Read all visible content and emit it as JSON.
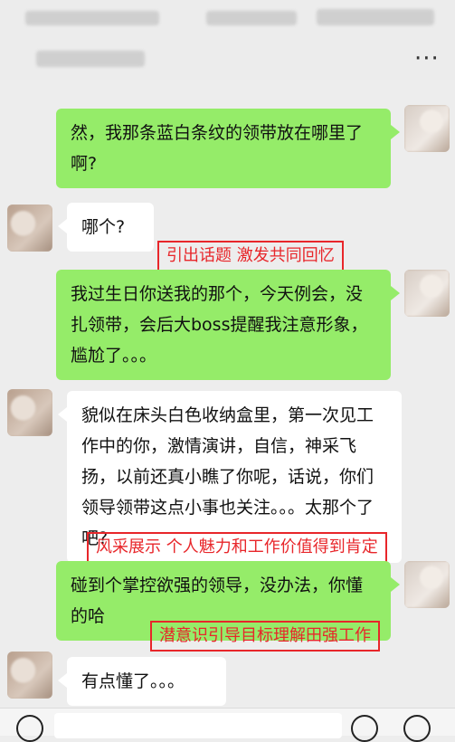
{
  "messages": [
    {
      "side": "right",
      "text": "然，我那条蓝白条纹的领带放在哪里了啊?"
    },
    {
      "side": "left",
      "text": "哪个?"
    },
    {
      "side": "right",
      "text": "我过生日你送我的那个，今天例会，没扎领带，会后大boss提醒我注意形象，尴尬了。。。"
    },
    {
      "side": "left",
      "text": "貌似在床头白色收纳盒里，第一次见工作中的你，激情演讲，自信，神采飞扬，以前还真小瞧了你呢，话说，你们领导领带这点小事也关注。。。太那个了吧?"
    },
    {
      "side": "right",
      "text": "碰到个掌控欲强的领导，没办法，你懂的哈"
    },
    {
      "side": "left",
      "text": "有点懂了。。。"
    }
  ],
  "annotations": [
    "引出话题 激发共同回忆",
    "风采展示  个人魅力和工作价值得到肯定",
    "潜意识引导目标理解田强工作"
  ],
  "header": {
    "more_icon": "more-icon"
  },
  "bottom_bar": {
    "voice_icon": "voice-icon",
    "emoji_icon": "emoji-icon",
    "add_icon": "add-icon"
  },
  "colors": {
    "sent_bubble": "#95ec69",
    "received_bubble": "#ffffff",
    "annotation": "#e8262a",
    "background": "#ededed"
  }
}
